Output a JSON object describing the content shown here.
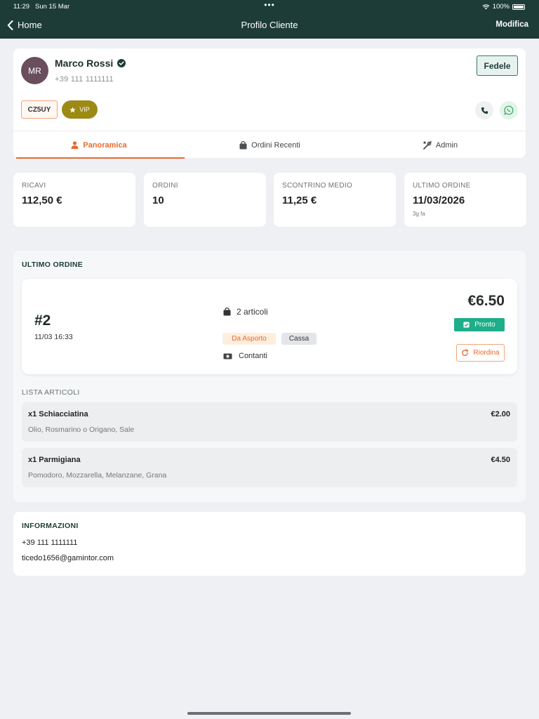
{
  "status_bar": {
    "time": "11:29",
    "date": "Sun 15 Mar",
    "dots": "•••",
    "battery": "100%"
  },
  "nav": {
    "back_label": "Home",
    "title": "Profilo Cliente",
    "edit_label": "Modifica"
  },
  "customer": {
    "initials": "MR",
    "name": "Marco Rossi",
    "phone": "+39 111 1111111",
    "loyalty_label": "Fedele",
    "code": "CZ5UY",
    "vip_label": "VIP"
  },
  "tabs": [
    {
      "label": "Panoramica",
      "icon": "person-icon",
      "active": true
    },
    {
      "label": "Ordini Recenti",
      "icon": "bag-icon",
      "active": false
    },
    {
      "label": "Admin",
      "icon": "tools-icon",
      "active": false
    }
  ],
  "stats": [
    {
      "label": "RICAVI",
      "value": "112,50 €",
      "sub": ""
    },
    {
      "label": "ORDINI",
      "value": "10",
      "sub": ""
    },
    {
      "label": "SCONTRINO MEDIO",
      "value": "11,25 €",
      "sub": ""
    },
    {
      "label": "ULTIMO ORDINE",
      "value": "11/03/2026",
      "sub": "3g fa"
    }
  ],
  "last_order": {
    "section_title": "ULTIMO ORDINE",
    "number": "#2",
    "datetime": "11/03 16:33",
    "items_count": "2 articoli",
    "tag_type": "Da Asporto",
    "tag_source": "Cassa",
    "payment": "Contanti",
    "total": "€6.50",
    "status_label": "Pronto",
    "reorder_label": "Riordina"
  },
  "item_list": {
    "section_title": "LISTA ARTICOLI",
    "items": [
      {
        "qty_name": "x1  Schiacciatina",
        "price": "€2.00",
        "desc": "Olio, Rosmarino o Origano, Sale"
      },
      {
        "qty_name": "x1  Parmigiana",
        "price": "€4.50",
        "desc": "Pomodoro, Mozzarella, Melanzane, Grana"
      }
    ]
  },
  "info": {
    "section_title": "INFORMAZIONI",
    "phone": "+39 111 1111111",
    "email": "ticedo1656@gamintor.com"
  },
  "colors": {
    "header": "#1d3c38",
    "accent": "#e8692f",
    "success": "#1fae8a",
    "vip": "#9c8a14"
  }
}
